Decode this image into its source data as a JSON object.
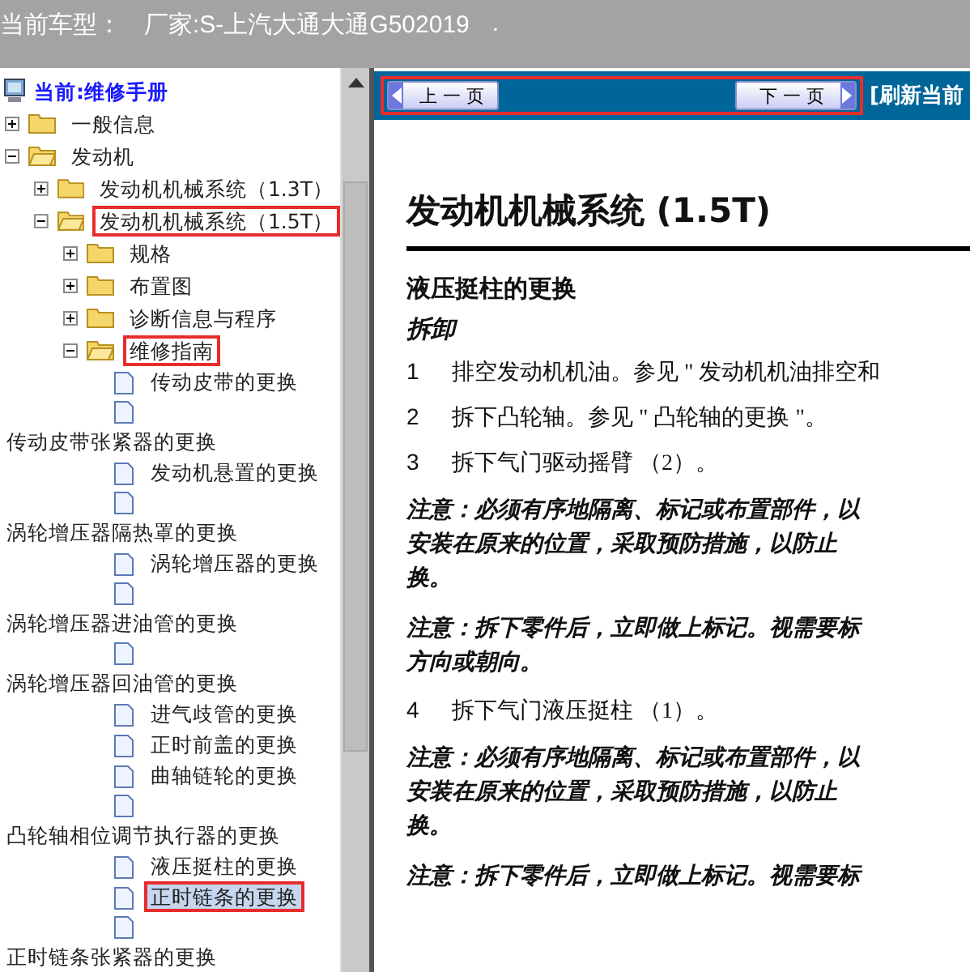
{
  "header": {
    "label": "当前车型：",
    "value": "厂家:S-上汽大通大通G502019",
    "suffix": "."
  },
  "tree": {
    "root": "当前:维修手册",
    "items": [
      {
        "kind": "folder",
        "label": "一般信息",
        "expanded": false,
        "highlighted": false,
        "selected": false
      },
      {
        "kind": "folder",
        "label": "发动机",
        "expanded": true,
        "highlighted": false,
        "selected": false,
        "children": [
          {
            "kind": "folder",
            "label": "发动机机械系统（1.3T）",
            "expanded": false,
            "highlighted": false,
            "selected": false
          },
          {
            "kind": "folder",
            "label": "发动机机械系统（1.5T）",
            "expanded": true,
            "highlighted": true,
            "selected": false,
            "children": [
              {
                "kind": "folder",
                "label": "规格",
                "expanded": false,
                "highlighted": false,
                "selected": false
              },
              {
                "kind": "folder",
                "label": "布置图",
                "expanded": false,
                "highlighted": false,
                "selected": false
              },
              {
                "kind": "folder",
                "label": "诊断信息与程序",
                "expanded": false,
                "highlighted": false,
                "selected": false
              },
              {
                "kind": "folder",
                "label": "维修指南",
                "expanded": true,
                "highlighted": true,
                "selected": false,
                "children": [
                  {
                    "kind": "doc",
                    "label": "传动皮带的更换",
                    "highlighted": false,
                    "selected": false
                  },
                  {
                    "kind": "doc",
                    "label": "传动皮带张紧器的更换",
                    "highlighted": false,
                    "selected": false
                  },
                  {
                    "kind": "doc",
                    "label": "发动机悬置的更换",
                    "highlighted": false,
                    "selected": false
                  },
                  {
                    "kind": "doc",
                    "label": "涡轮增压器隔热罩的更换",
                    "highlighted": false,
                    "selected": false
                  },
                  {
                    "kind": "doc",
                    "label": "涡轮增压器的更换",
                    "highlighted": false,
                    "selected": false
                  },
                  {
                    "kind": "doc",
                    "label": "涡轮增压器进油管的更换",
                    "highlighted": false,
                    "selected": false
                  },
                  {
                    "kind": "doc",
                    "label": "涡轮增压器回油管的更换",
                    "highlighted": false,
                    "selected": false
                  },
                  {
                    "kind": "doc",
                    "label": "进气歧管的更换",
                    "highlighted": false,
                    "selected": false
                  },
                  {
                    "kind": "doc",
                    "label": "正时前盖的更换",
                    "highlighted": false,
                    "selected": false
                  },
                  {
                    "kind": "doc",
                    "label": "曲轴链轮的更换",
                    "highlighted": false,
                    "selected": false
                  },
                  {
                    "kind": "doc",
                    "label": "凸轮轴相位调节执行器的更换",
                    "highlighted": false,
                    "selected": false
                  },
                  {
                    "kind": "doc",
                    "label": "液压挺柱的更换",
                    "highlighted": false,
                    "selected": false
                  },
                  {
                    "kind": "doc",
                    "label": "正时链条的更换",
                    "highlighted": true,
                    "selected": true
                  },
                  {
                    "kind": "doc",
                    "label": "正时链条张紧器的更换",
                    "highlighted": false,
                    "selected": false
                  }
                ]
              }
            ]
          }
        ]
      }
    ]
  },
  "nav": {
    "highlighted": true,
    "prev": "上 一 页",
    "next": "下 一 页",
    "refresh": "[刷新当前"
  },
  "document": {
    "title": "发动机机械系统 (1.5T)",
    "section": "液压挺柱的更换",
    "subsection": "拆卸",
    "blocks": [
      {
        "kind": "step",
        "number": "1",
        "text": "排空发动机机油。参见 \" 发动机机油排空和"
      },
      {
        "kind": "step",
        "number": "2",
        "text": "拆下凸轮轴。参见 \" 凸轮轴的更换 \"。"
      },
      {
        "kind": "step",
        "number": "3",
        "text": "拆下气门驱动摇臂 （2）。"
      },
      {
        "kind": "note",
        "lines": [
          "注意：必须有序地隔离、标记或布置部件，以",
          "安装在原来的位置，采取预防措施，以防止",
          "换。"
        ]
      },
      {
        "kind": "note",
        "lines": [
          "注意：拆下零件后，立即做上标记。视需要标",
          "方向或朝向。"
        ]
      },
      {
        "kind": "step",
        "number": "4",
        "text": "拆下气门液压挺柱 （1）。"
      },
      {
        "kind": "note",
        "lines": [
          "注意：必须有序地隔离、标记或布置部件，以",
          "安装在原来的位置，采取预防措施，以防止",
          "换。"
        ]
      },
      {
        "kind": "note",
        "lines": [
          "注意：拆下零件后，立即做上标记。视需要标"
        ]
      }
    ]
  }
}
